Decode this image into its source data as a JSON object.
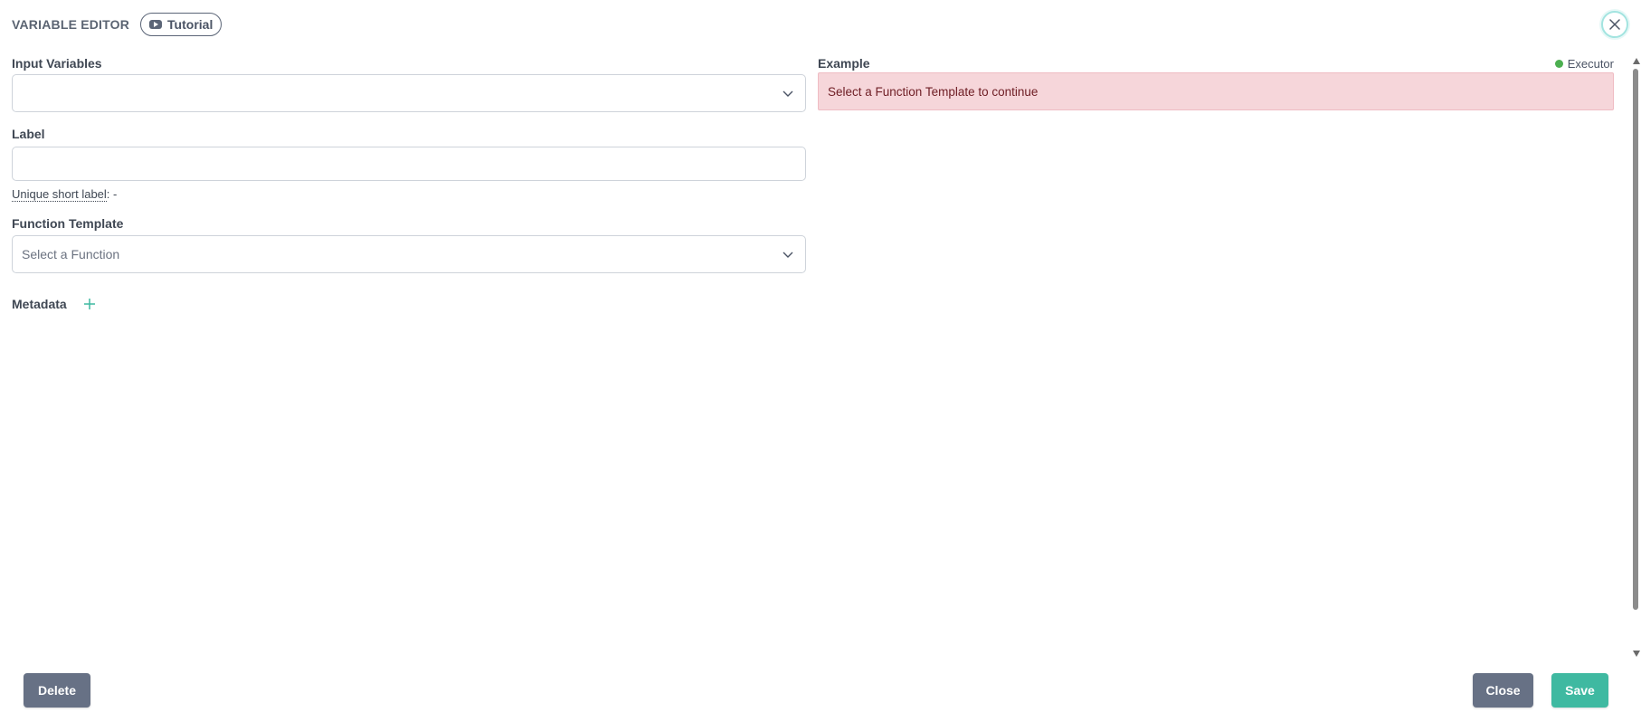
{
  "header": {
    "title": "VARIABLE EDITOR",
    "tutorial_label": "Tutorial"
  },
  "form": {
    "input_variables": {
      "label": "Input Variables",
      "value": ""
    },
    "label": {
      "label": "Label",
      "value": ""
    },
    "unique_short_label": {
      "prefix": "Unique short label",
      "suffix": ": -"
    },
    "function_template": {
      "label": "Function Template",
      "placeholder": "Select a Function"
    },
    "metadata": {
      "label": "Metadata"
    }
  },
  "example": {
    "label": "Example",
    "executor_label": "Executor",
    "executor_status_color": "#4caf50",
    "alert_text": "Select a Function Template to continue"
  },
  "footer": {
    "delete_label": "Delete",
    "close_label": "Close",
    "save_label": "Save"
  },
  "colors": {
    "primary_teal": "#3fb9a1",
    "secondary_gray": "#677185",
    "alert_bg": "#f6d6da",
    "alert_text": "#6e1d24"
  }
}
